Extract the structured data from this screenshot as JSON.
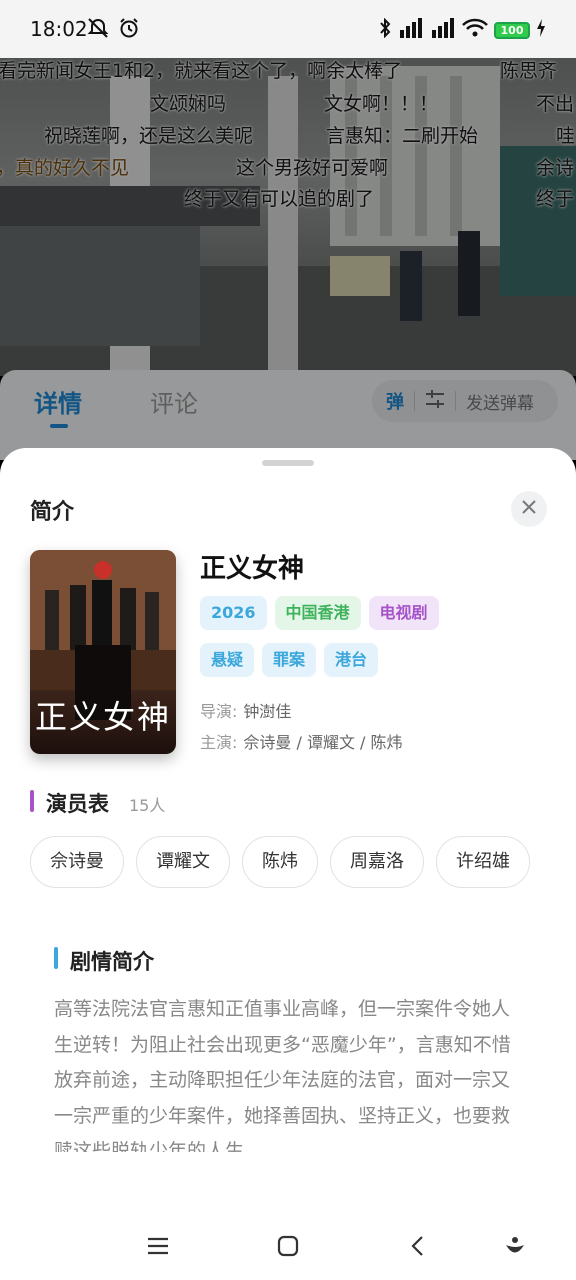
{
  "status_bar": {
    "time": "18:02",
    "battery": "100"
  },
  "danmaku": [
    "看完新闻女王1和2，就来看这个了，啊余太棒了",
    "陈思齐",
    "文颂娴吗",
    "文女啊！！！",
    "不出",
    "祝晓莲啊，还是这么美呢",
    "言惠知：二刷开始",
    "哇",
    "，真的好久不见",
    "这个男孩好可爱啊",
    "余诗",
    "终于又有可以追的剧了",
    "终于"
  ],
  "detail_tabs": {
    "detail": "详情",
    "comments": "评论",
    "danmaku_toggle": "弹",
    "send_danmaku": "发送弹幕"
  },
  "sheet": {
    "title": "简介",
    "show": {
      "title": "正义女神",
      "poster_title": "正义女神",
      "tags_row1": [
        "2026",
        "中国香港",
        "电视剧"
      ],
      "tags_row2": [
        "悬疑",
        "罪案",
        "港台"
      ],
      "director_label": "导演:",
      "director": "钟澍佳",
      "cast_label": "主演:",
      "main_cast": "佘诗曼 / 谭耀文 / 陈炜"
    },
    "cast": {
      "heading": "演员表",
      "count": "15人",
      "members": [
        "佘诗曼",
        "谭耀文",
        "陈炜",
        "周嘉洛",
        "许绍雄"
      ]
    },
    "plot": {
      "heading": "剧情简介",
      "text": "高等法院法官言惠知正值事业高峰，但一宗案件令她人生逆转！为阻止社会出现更多“恶魔少年”，言惠知不惜放弃前途，主动降职担任少年法庭的法官，面对一宗又一宗严重的少年案件，她择善固执、坚持正义，也要救赎这些脱轨少年的人生。"
    }
  },
  "colors": {
    "accent_blue": "#1f8ad6",
    "cast_bar": "#a653c9",
    "plot_bar": "#3ba7dc"
  }
}
